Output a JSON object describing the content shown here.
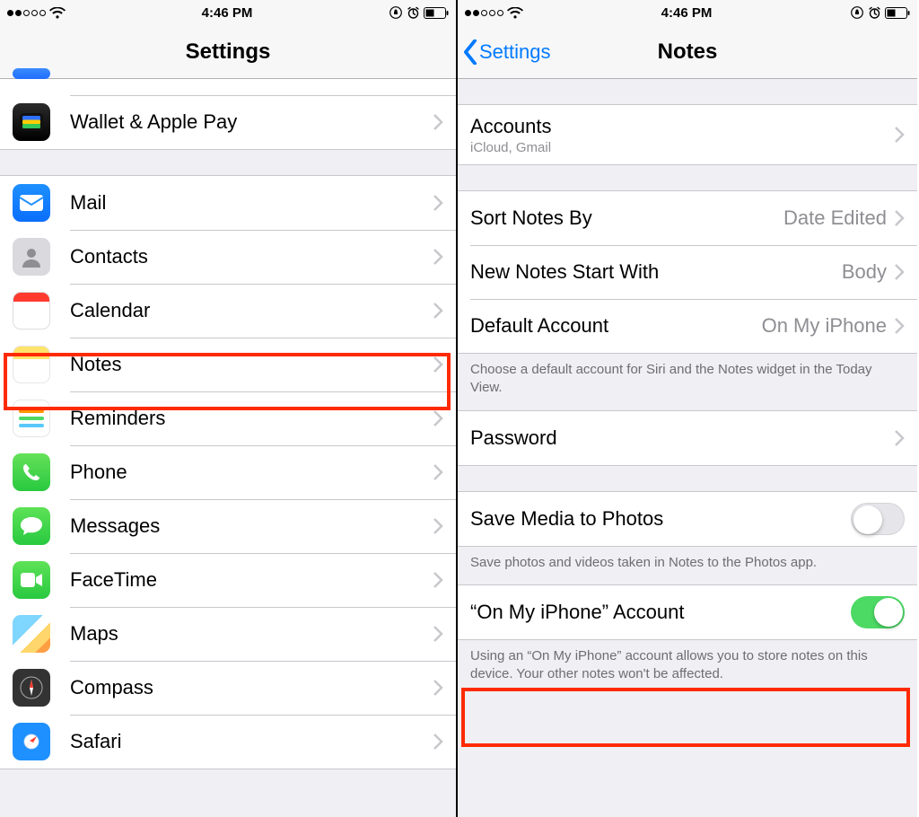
{
  "status": {
    "time": "4:46 PM"
  },
  "left": {
    "title": "Settings",
    "partial": {
      "label": ""
    },
    "wallet": {
      "label": "Wallet & Apple Pay"
    },
    "items": [
      {
        "label": "Mail"
      },
      {
        "label": "Contacts"
      },
      {
        "label": "Calendar"
      },
      {
        "label": "Notes"
      },
      {
        "label": "Reminders"
      },
      {
        "label": "Phone"
      },
      {
        "label": "Messages"
      },
      {
        "label": "FaceTime"
      },
      {
        "label": "Maps"
      },
      {
        "label": "Compass"
      },
      {
        "label": "Safari"
      }
    ]
  },
  "right": {
    "back": "Settings",
    "title": "Notes",
    "accounts": {
      "label": "Accounts",
      "sub": "iCloud, Gmail"
    },
    "sort": {
      "label": "Sort Notes By",
      "value": "Date Edited"
    },
    "start": {
      "label": "New Notes Start With",
      "value": "Body"
    },
    "defaultAcct": {
      "label": "Default Account",
      "value": "On My iPhone"
    },
    "footer1": "Choose a default account for Siri and the Notes widget in the Today View.",
    "password": {
      "label": "Password"
    },
    "savemedia": {
      "label": "Save Media to Photos"
    },
    "footer2": "Save photos and videos taken in Notes to the Photos app.",
    "omi": {
      "label": "“On My iPhone” Account"
    },
    "footer3": "Using an “On My iPhone” account allows you to store notes on this device. Your other notes won't be affected."
  }
}
